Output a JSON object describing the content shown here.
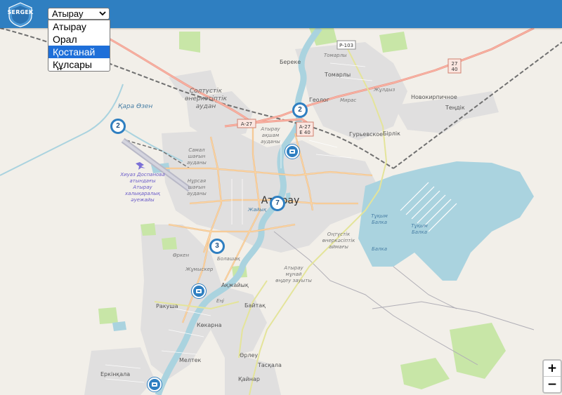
{
  "header": {
    "logo_text": "SERGEK",
    "city_select": {
      "value": "Атырау",
      "options": [
        "Атырау",
        "Орал",
        "Қостанай",
        "Құлсары"
      ],
      "highlighted": "Қостанай"
    }
  },
  "map": {
    "place_labels": {
      "kara_ozen": "Қара Өзен",
      "soltustik_1": "Солтүстік",
      "soltustik_2": "өнеркәсіптік",
      "soltustik_3": "аудан",
      "bereke": "Береке",
      "tomarly_small": "Томарлы",
      "tomarly": "Томарлы",
      "geolog": "Геолог",
      "miras": "Мирас",
      "zhuldyz": "Жұлдыз",
      "novokirpichnoe": "Новокирпичное",
      "tendik": "Теңдік",
      "guryevskoe": "Гурьевское",
      "birlik": "Бірлік",
      "atyrau_district_1": "Атырау",
      "atyrau_district_2": "ақшам",
      "atyrau_district_3": "ауданы",
      "samal_1": "Самал",
      "samal_2": "шағын",
      "samal_3": "ауданы",
      "nursaya_1": "Нұрсая",
      "nursaya_2": "шағын",
      "nursaya_3": "ауданы",
      "airport_1": "Хиуаз Доспанова",
      "airport_2": "атындағы",
      "airport_3": "Атырау",
      "airport_4": "халықаралық",
      "airport_5": "әуежайы",
      "city": "Атырау",
      "zhaiyk": "Жайық",
      "tukym_1": "Тұқым",
      "tukym_2": "Балка",
      "tukym_3": "Балка",
      "tukym_4": "Тұқым",
      "tukym_5": "Балка",
      "ontustik_1": "Оңтүстік",
      "ontustik_2": "өнеркәсіптік",
      "ontustik_3": "аймағы",
      "orken": "Өркен",
      "zhumysker": "Жұмыскер",
      "bolashak": "Болашақ",
      "atyrau_zauyt_1": "Атырау",
      "atyrau_zauyt_2": "мұнай",
      "atyrau_zauyt_3": "өңдеу зауыты",
      "akzhaiyk": "Ақжайық",
      "eng": "Еңі",
      "bayitakh": "Байтақ",
      "rakusha": "Ракуша",
      "kokarna": "Көкарна",
      "orley": "Өрлеу",
      "meltek": "Мелтек",
      "taskala": "Тасқала",
      "erkinkala": "Еркінқала",
      "kaynar": "Қайнар"
    },
    "road_shields": {
      "r103": "Р-103",
      "r27_40_top": "27",
      "r27_40_bottom": "40",
      "a27": "А-27",
      "a27_e40_top": "А-27",
      "a27_e40_bottom": "Е 40"
    },
    "cluster_markers": {
      "west": "2",
      "north": "2",
      "center": "7",
      "southwest": "3"
    }
  },
  "zoom": {
    "in_label": "+",
    "out_label": "−"
  },
  "colors": {
    "header_bg": "#2f7fc1",
    "marker_blue": "#2f7fc1",
    "water": "#aad3df",
    "land": "#f2efe9",
    "residential": "#e0dfdf",
    "primary_road": "#fcd6a4",
    "secondary_road": "#f7fabf",
    "trunk_road": "#f8b0a3",
    "railway": "#707070"
  }
}
